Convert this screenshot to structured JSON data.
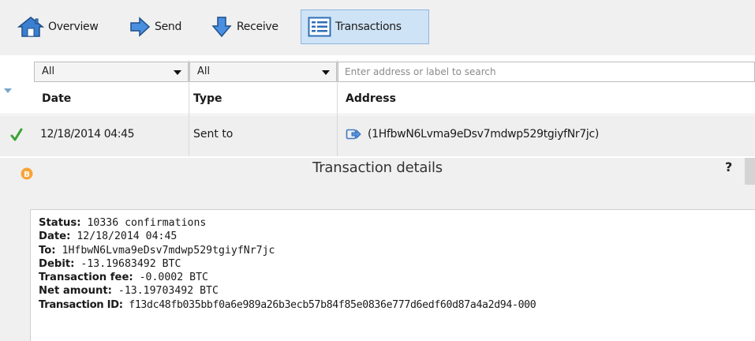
{
  "toolbar": {
    "items": [
      {
        "label": "Overview",
        "icon": "home-icon"
      },
      {
        "label": "Send",
        "icon": "send-arrow-icon"
      },
      {
        "label": "Receive",
        "icon": "receive-arrow-icon"
      },
      {
        "label": "Transactions",
        "icon": "transactions-list-icon",
        "active": true
      }
    ]
  },
  "filters": {
    "date_filter": "All",
    "type_filter": "All",
    "search_placeholder": "Enter address or label to search"
  },
  "table": {
    "columns": [
      "Date",
      "Type",
      "Address"
    ],
    "rows": [
      {
        "status_icon": "checkmark-icon",
        "date": "12/18/2014 04:45",
        "type": "Sent to",
        "address": "(1HfbwN6Lvma9eDsv7mdwp529tgiyfNr7jc)"
      }
    ]
  },
  "details": {
    "title": "Transaction details",
    "help": "?",
    "fields": [
      {
        "label": "Status:",
        "value": " 10336 confirmations"
      },
      {
        "label": "Date:",
        "value": " 12/18/2014 04:45"
      },
      {
        "label": "To:",
        "value": " 1HfbwN6Lvma9eDsv7mdwp529tgiyfNr7jc"
      },
      {
        "label": "Debit:",
        "value": " -13.19683492 BTC"
      },
      {
        "label": "Transaction fee:",
        "value": " -0.0002 BTC"
      },
      {
        "label": "Net amount:",
        "value": " -13.19703492 BTC"
      },
      {
        "label": "Transaction ID:",
        "value": " f13dc48fb035bbf0a6e989a26b3ecb57b84f85e0836e777d6edf60d87a4a2d94-000"
      }
    ]
  },
  "colors": {
    "toolbar_bg": "#f0f0f0",
    "active_tab_bg": "#cfe3f6",
    "check_green": "#3aa335",
    "bitcoin_orange": "#f7a43a",
    "icon_blue": "#2f6fb8"
  }
}
